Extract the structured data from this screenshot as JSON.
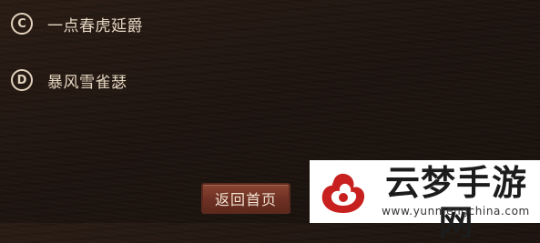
{
  "options": [
    {
      "letter": "C",
      "text": "一点春虎延爵"
    },
    {
      "letter": "D",
      "text": "暴风雪雀瑟"
    }
  ],
  "back_button_label": "返回首页",
  "watermark": {
    "brand": "云梦手游网",
    "url": "www.yunmengchina.com",
    "colors": {
      "logo": "#c8201e",
      "text": "#1c1c1c"
    }
  },
  "colors": {
    "background": "#1f1510",
    "option_text": "#e6d7c2",
    "button_bg": "#6d3023"
  }
}
